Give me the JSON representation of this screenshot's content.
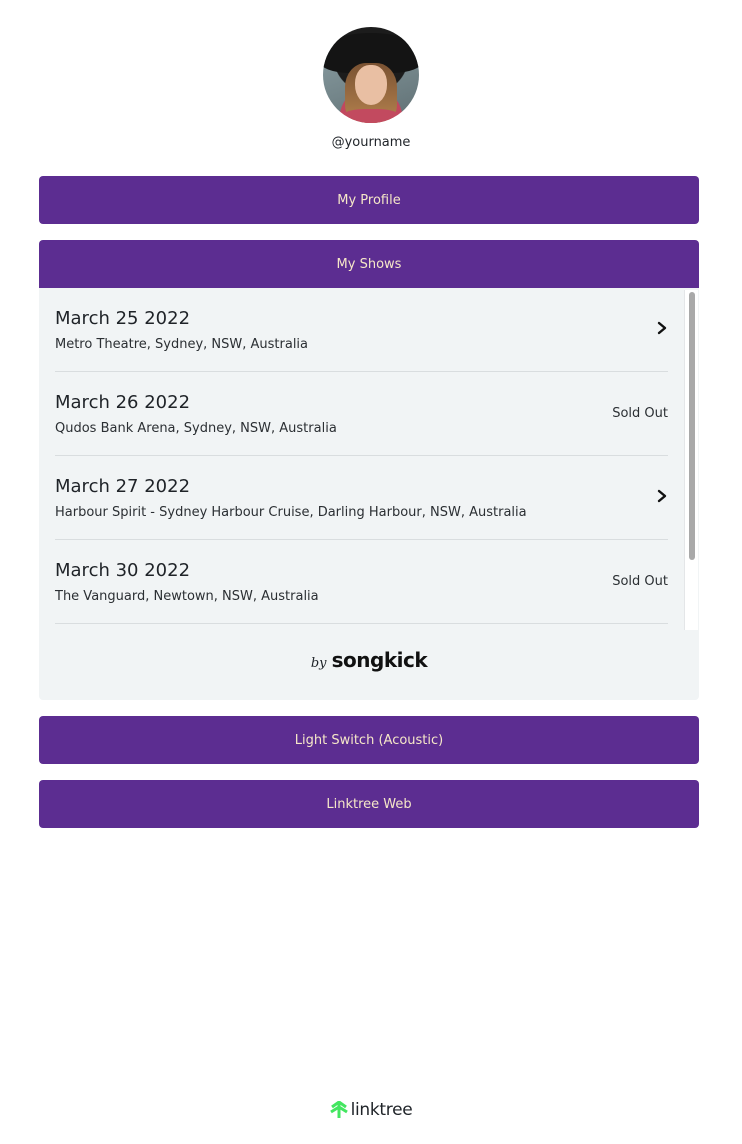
{
  "profile": {
    "username": "@yourname"
  },
  "links": {
    "my_profile": "My Profile",
    "my_shows": "My Shows",
    "light_switch": "Light Switch (Acoustic)",
    "linktree_web": "Linktree Web"
  },
  "shows": [
    {
      "date": "March 25 2022",
      "venue": "Metro Theatre, Sydney, NSW, Australia",
      "status": "",
      "icon": "chevron-right-icon"
    },
    {
      "date": "March 26 2022",
      "venue": "Qudos Bank Arena, Sydney, NSW, Australia",
      "status": "Sold Out",
      "icon": ""
    },
    {
      "date": "March 27 2022",
      "venue": "Harbour Spirit - Sydney Harbour Cruise, Darling Harbour, NSW, Australia",
      "status": "",
      "icon": "chevron-right-icon"
    },
    {
      "date": "March 30 2022",
      "venue": "The Vanguard, Newtown, NSW, Australia",
      "status": "Sold Out",
      "icon": ""
    }
  ],
  "songkick": {
    "by": "by",
    "brand": "songkick"
  },
  "footer": {
    "brand": "linktree"
  },
  "colors": {
    "button_bg": "#5c2d91",
    "button_text": "#f6e7c8",
    "panel_bg": "#f1f4f5",
    "linktree_green": "#43e660"
  }
}
